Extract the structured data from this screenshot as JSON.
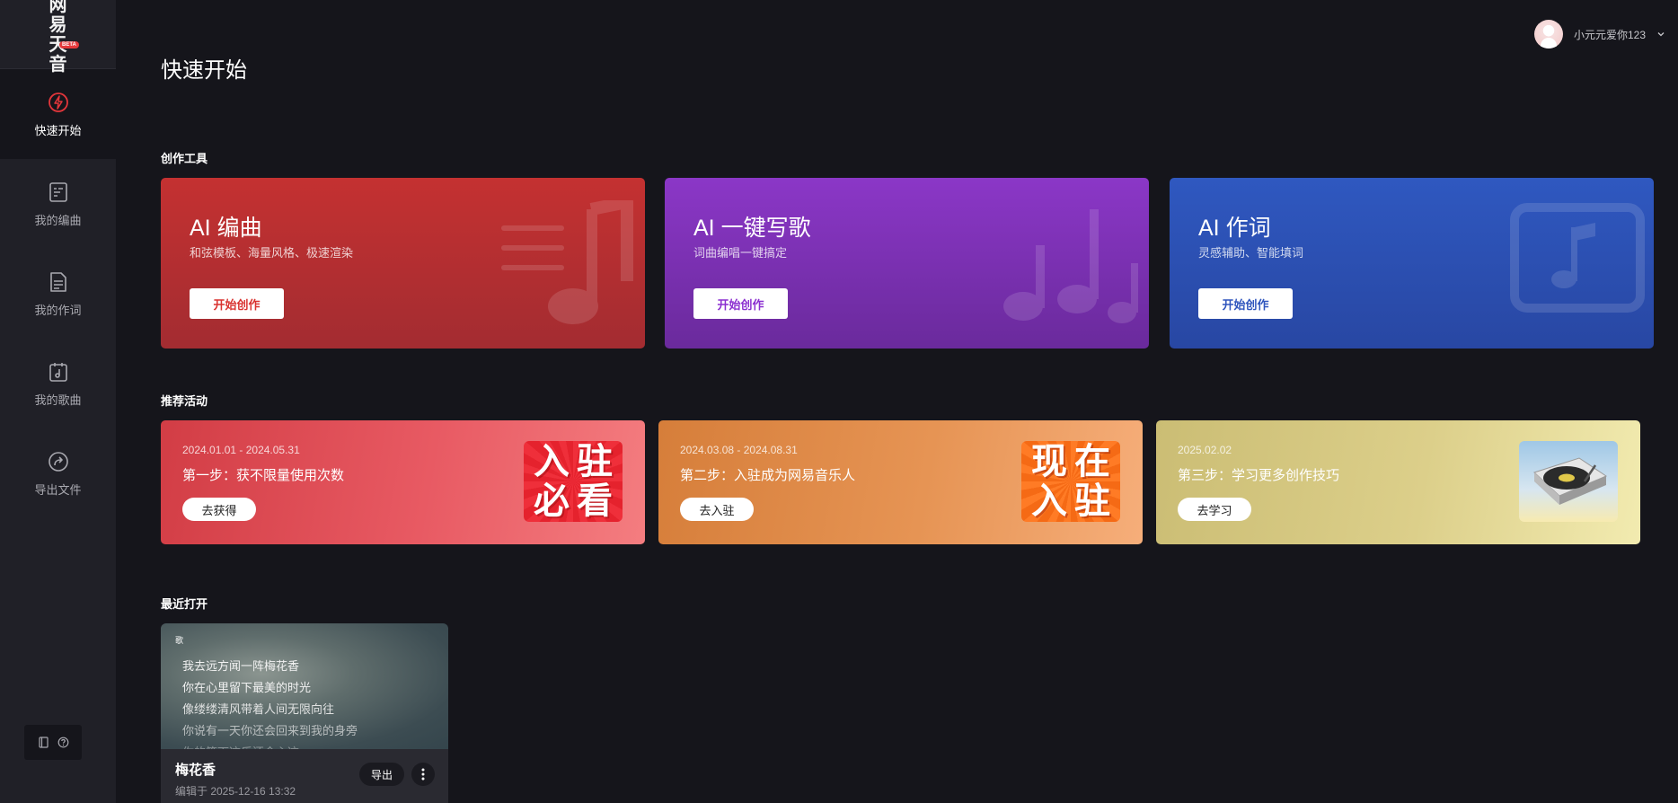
{
  "logo": {
    "text": "网易天音",
    "badge": "BETA"
  },
  "sidebar": {
    "items": [
      {
        "label": "快速开始"
      },
      {
        "label": "我的编曲"
      },
      {
        "label": "我的作词"
      },
      {
        "label": "我的歌曲"
      },
      {
        "label": "导出文件"
      }
    ]
  },
  "header": {
    "title": "快速开始",
    "username": "小元元爱你123"
  },
  "sections": {
    "tools": "创作工具",
    "activities": "推荐活动",
    "recent": "最近打开"
  },
  "tools": [
    {
      "title": "AI 编曲",
      "subtitle": "和弦模板、海量风格、极速渲染",
      "button": "开始创作",
      "color": "#c53232"
    },
    {
      "title": "AI 一键写歌",
      "subtitle": "词曲编唱一键搞定",
      "button": "开始创作",
      "color": "#8a35c8"
    },
    {
      "title": "AI 作词",
      "subtitle": "灵感辅助、智能填词",
      "button": "开始创作",
      "color": "#2f55bd"
    }
  ],
  "activities": [
    {
      "date": "2024.01.01 - 2024.05.31",
      "title": "第一步：获不限量使用次数",
      "button": "去获得",
      "image_text": [
        "入",
        "驻",
        "必",
        "看"
      ]
    },
    {
      "date": "2024.03.08 - 2024.08.31",
      "title": "第二步：入驻成为网易音乐人",
      "button": "去入驻",
      "image_text": [
        "现",
        "在",
        "入",
        "驻"
      ]
    },
    {
      "date": "2025.02.02",
      "title": "第三步：学习更多创作技巧",
      "button": "去学习"
    }
  ],
  "recent": {
    "tag": "歌",
    "lyrics": [
      "我去远方闻一阵梅花香",
      "你在心里留下最美的时光",
      "像缕缕清风带着人间无限向往",
      "你说有一天你还会回来到我的身旁",
      "你的笑下这乐还会心这"
    ],
    "name": "梅花香",
    "edited": "编辑于 2025-12-16 13:32",
    "export": "导出"
  }
}
